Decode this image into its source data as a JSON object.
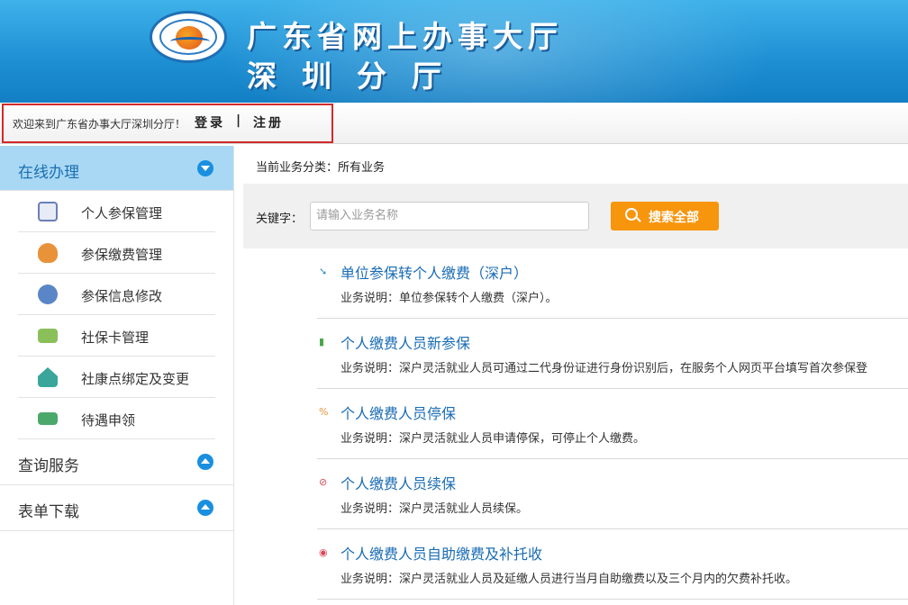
{
  "header": {
    "title_line1": "广东省网上办事大厅",
    "title_line2": "深圳分厅"
  },
  "topbar": {
    "welcome": "欢迎来到广东省办事大厅深圳分厅！",
    "login": "登录",
    "separator": "|",
    "register": "注册"
  },
  "sidebar": {
    "sections": [
      {
        "label": "在线办理",
        "expanded": true
      },
      {
        "label": "查询服务",
        "expanded": false
      },
      {
        "label": "表单下载",
        "expanded": false
      }
    ],
    "items": [
      {
        "label": "个人参保管理",
        "icon": "person-badge-icon",
        "color": "#6a7fb8"
      },
      {
        "label": "参保缴费管理",
        "icon": "money-bag-icon",
        "color": "#e8923a"
      },
      {
        "label": "参保信息修改",
        "icon": "user-edit-icon",
        "color": "#5a86c8"
      },
      {
        "label": "社保卡管理",
        "icon": "card-icon",
        "color": "#8bbf5a"
      },
      {
        "label": "社康点绑定及变更",
        "icon": "house-icon",
        "color": "#3aa59a"
      },
      {
        "label": "待遇申领",
        "icon": "cash-icon",
        "color": "#4aa86a"
      }
    ]
  },
  "main": {
    "category_label": "当前业务分类：所有业务",
    "keyword_label": "关键字：",
    "keyword_placeholder": "请输入业务名称",
    "search_button": "搜索全部",
    "items": [
      {
        "title": "单位参保转个人缴费（深户）",
        "desc": "业务说明：单位参保转个人缴费（深户）。",
        "icon": "arrow-icon",
        "color": "#2a8fd0"
      },
      {
        "title": "个人缴费人员新参保",
        "desc": "业务说明：深户灵活就业人员可通过二代身份证进行身份识别后，在服务个人网页平台填写首次参保登",
        "icon": "bars-icon",
        "color": "#4aa84a"
      },
      {
        "title": "个人缴费人员停保",
        "desc": "业务说明：深户灵活就业人员申请停保，可停止个人缴费。",
        "icon": "percent-icon",
        "color": "#e8923a"
      },
      {
        "title": "个人缴费人员续保",
        "desc": "业务说明：深户灵活就业人员续保。",
        "icon": "link-icon",
        "color": "#d84a5a"
      },
      {
        "title": "个人缴费人员自助缴费及补托收",
        "desc": "业务说明：深户灵活就业人员及延缴人员进行当月自助缴费以及三个月内的欠费补托收。",
        "icon": "coin-icon",
        "color": "#d84a5a"
      }
    ]
  }
}
